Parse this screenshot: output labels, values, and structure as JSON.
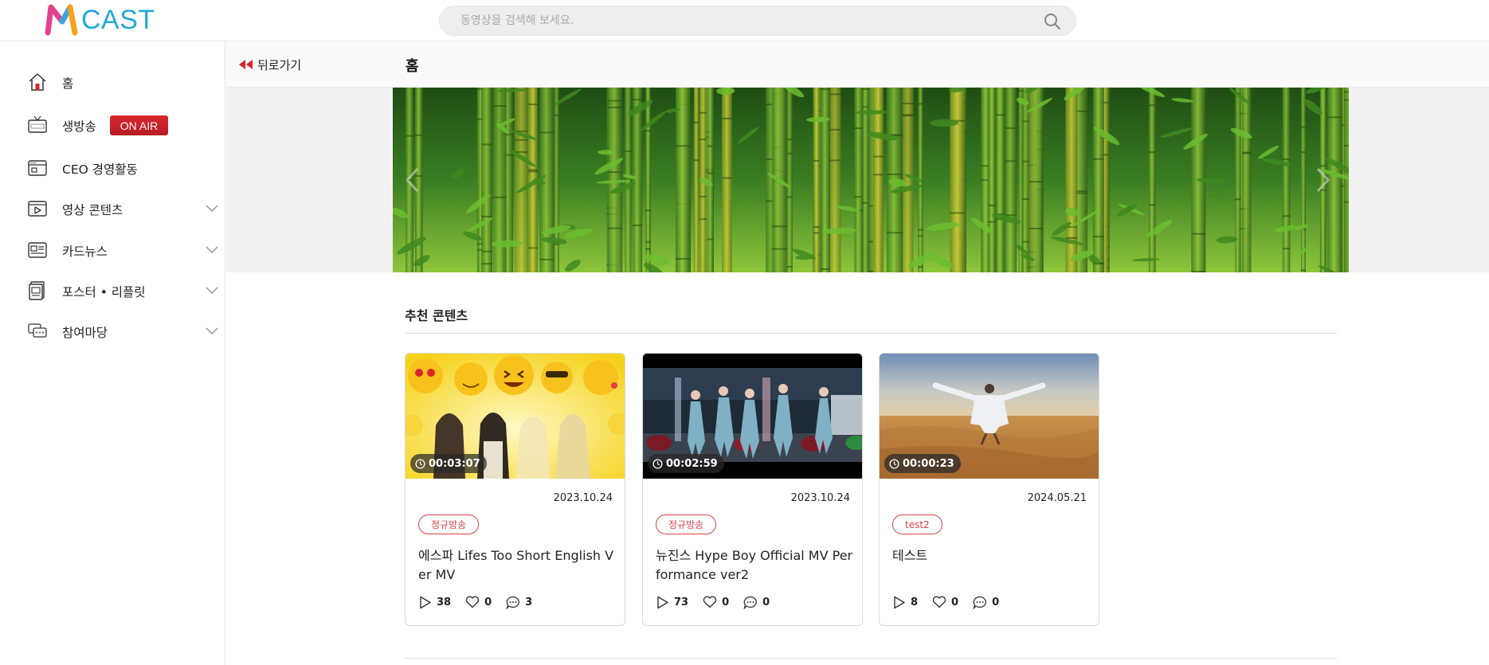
{
  "header": {
    "logo_text": "CAST",
    "search_placeholder": "동영상을 검색해 보세요."
  },
  "sidebar": {
    "items": [
      {
        "label": "홈",
        "icon": "home-icon"
      },
      {
        "label": "생방송",
        "icon": "tv-icon",
        "badge": "ON AIR"
      },
      {
        "label": "CEO 경영활동",
        "icon": "window-icon"
      },
      {
        "label": "영상 콘텐츠",
        "icon": "video-icon",
        "expandable": true
      },
      {
        "label": "카드뉴스",
        "icon": "newspaper-icon",
        "expandable": true
      },
      {
        "label": "포스터 • 리플릿",
        "icon": "poster-icon",
        "expandable": true
      },
      {
        "label": "참여마당",
        "icon": "chat-icon",
        "expandable": true
      }
    ]
  },
  "subbar": {
    "back_label": "뒤로가기",
    "page_title": "홈"
  },
  "section": {
    "title": "추천 콘텐츠"
  },
  "cards": [
    {
      "duration": "00:03:07",
      "date": "2023.10.24",
      "tag": "정규방송",
      "title": "에스파 Lifes Too Short English Ver MV",
      "views": "38",
      "likes": "0",
      "comments": "3"
    },
    {
      "duration": "00:02:59",
      "date": "2023.10.24",
      "tag": "정규방송",
      "title": "뉴진스 Hype Boy Official MV Performance ver2",
      "views": "73",
      "likes": "0",
      "comments": "0"
    },
    {
      "duration": "00:00:23",
      "date": "2024.05.21",
      "tag": "test2",
      "title": "테스트",
      "views": "8",
      "likes": "0",
      "comments": "0"
    }
  ],
  "colors": {
    "accent_red": "#d8262e",
    "tag_red": "#d8434a",
    "logo_blue": "#23a8d6"
  }
}
